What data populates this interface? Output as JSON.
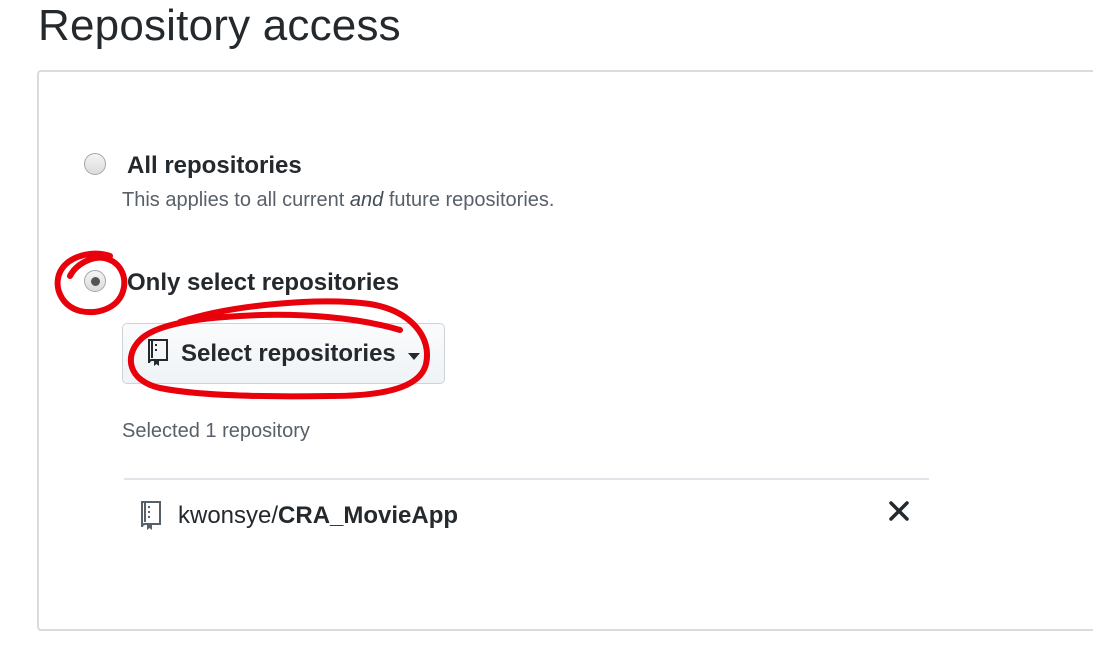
{
  "title": "Repository access",
  "options": {
    "all": {
      "label": "All repositories",
      "note_before": "This applies to all current ",
      "note_em": "and",
      "note_after": " future repositories.",
      "checked": false
    },
    "select": {
      "label": "Only select repositories",
      "checked": true
    }
  },
  "select_button": {
    "label": "Select repositories",
    "icon": "repo-icon"
  },
  "selected_count_text": "Selected 1 repository",
  "repos": [
    {
      "owner": "kwonsye/",
      "name": "CRA_MovieApp",
      "icon": "repo-icon",
      "remove_icon": "close-icon"
    }
  ],
  "colors": {
    "annotation": "#e8000b",
    "text": "#24292e",
    "muted": "#586069"
  }
}
